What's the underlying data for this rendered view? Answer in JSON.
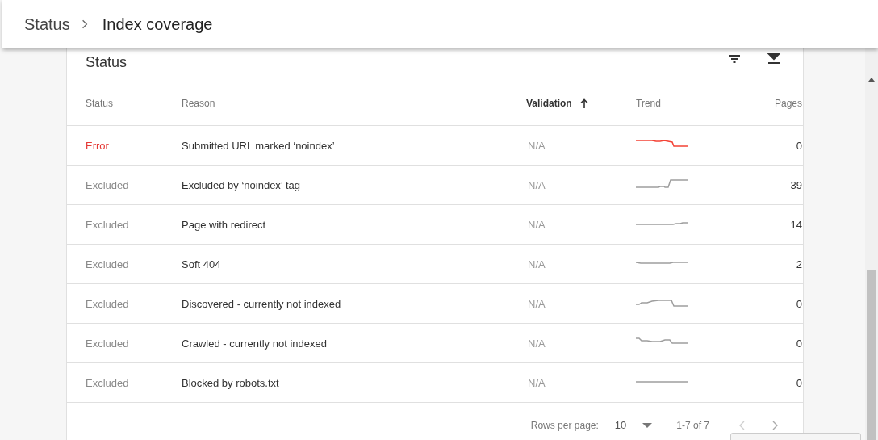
{
  "breadcrumb": {
    "parent": "Status",
    "current": "Index coverage"
  },
  "card": {
    "title": "Status"
  },
  "table": {
    "columns": [
      {
        "label": "Status",
        "sorted": false
      },
      {
        "label": "Reason",
        "sorted": false
      },
      {
        "label": "Validation",
        "sorted": true
      },
      {
        "label": "Trend",
        "sorted": false
      },
      {
        "label": "Pages",
        "sorted": false
      }
    ],
    "rows": [
      {
        "kind": "error",
        "status": "Error",
        "reason": "Submitted URL marked ‘noindex’",
        "validation": "N/A",
        "pages": "0"
      },
      {
        "kind": "excluded",
        "status": "Excluded",
        "reason": "Excluded by ‘noindex’ tag",
        "validation": "N/A",
        "pages": "39"
      },
      {
        "kind": "excluded",
        "status": "Excluded",
        "reason": "Page with redirect",
        "validation": "N/A",
        "pages": "14"
      },
      {
        "kind": "excluded",
        "status": "Excluded",
        "reason": "Soft 404",
        "validation": "N/A",
        "pages": "2"
      },
      {
        "kind": "excluded",
        "status": "Excluded",
        "reason": "Discovered - currently not indexed",
        "validation": "N/A",
        "pages": "0"
      },
      {
        "kind": "excluded",
        "status": "Excluded",
        "reason": "Crawled - currently not indexed",
        "validation": "N/A",
        "pages": "0"
      },
      {
        "kind": "excluded",
        "status": "Excluded",
        "reason": "Blocked by robots.txt",
        "validation": "N/A",
        "pages": "0"
      }
    ]
  },
  "pagination": {
    "rows_label": "Rows per page:",
    "rows_value": "10",
    "range": "1-7 of 7",
    "prev_disabled": true
  }
}
